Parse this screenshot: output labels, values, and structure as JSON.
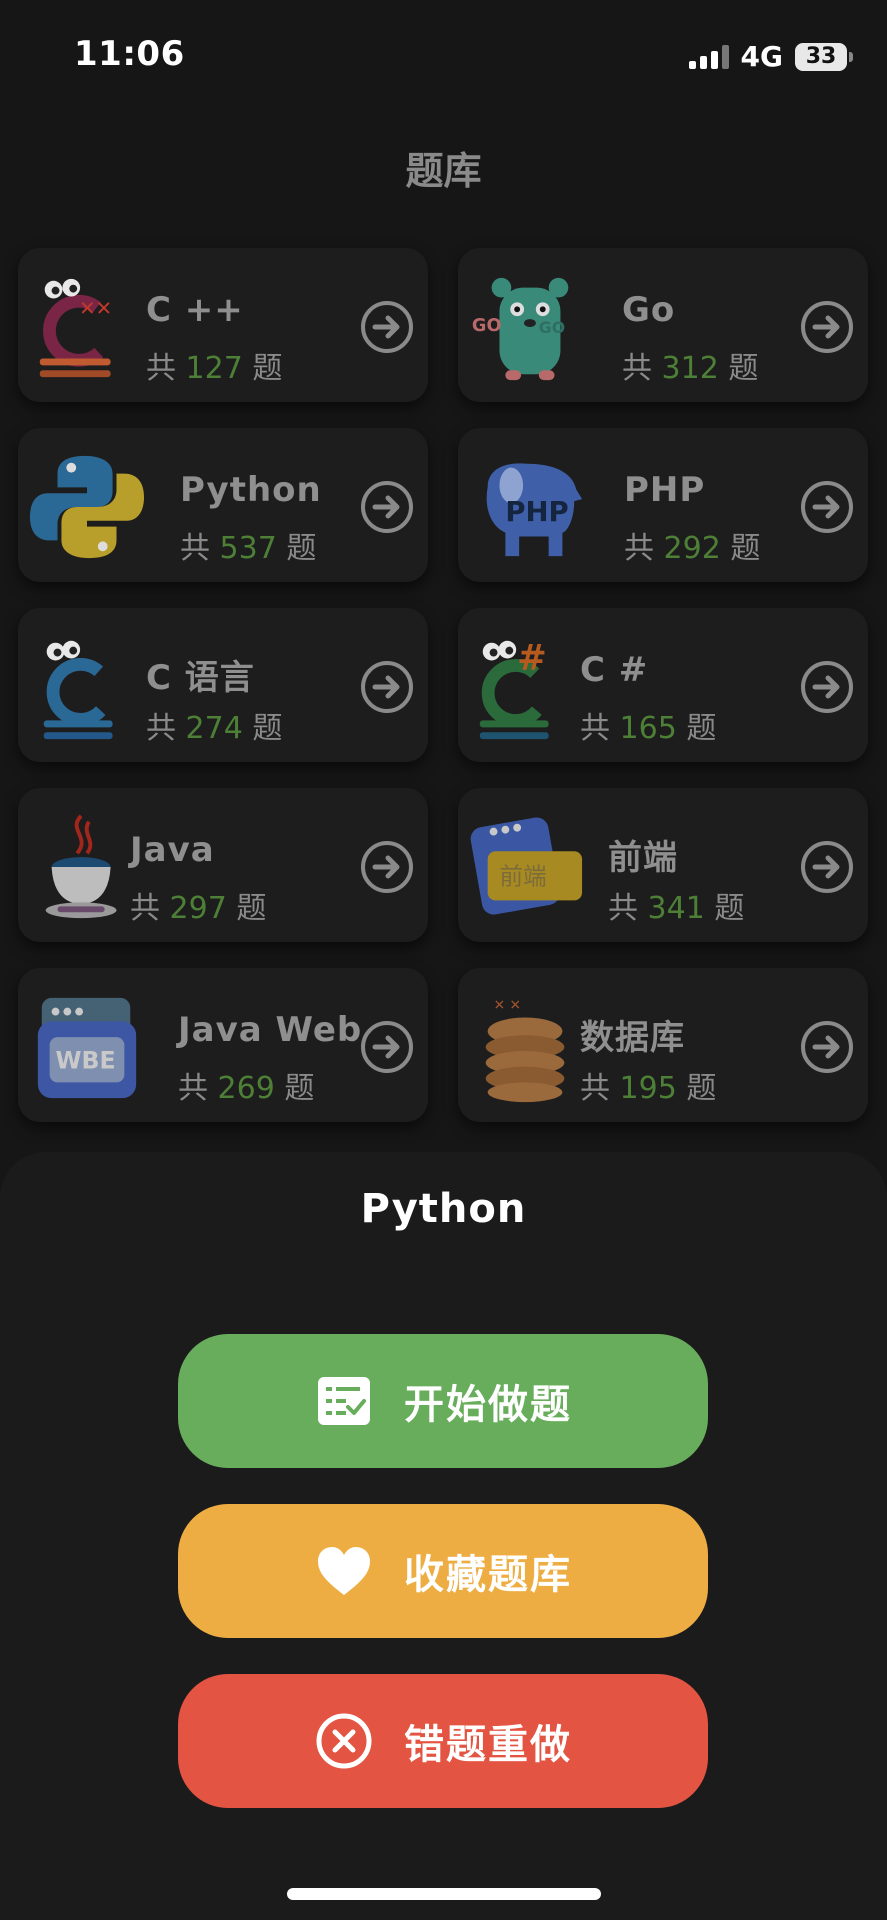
{
  "status_bar": {
    "time": "11:06",
    "network": "4G",
    "battery": "33"
  },
  "page_title": "题库",
  "cards": [
    {
      "id": "cpp",
      "name": "C ++",
      "prefix": "共",
      "count": "127",
      "suffix": "题"
    },
    {
      "id": "go",
      "name": "Go",
      "prefix": "共",
      "count": "312",
      "suffix": "题"
    },
    {
      "id": "python",
      "name": "Python",
      "prefix": "共",
      "count": "537",
      "suffix": "题"
    },
    {
      "id": "php",
      "name": "PHP",
      "prefix": "共",
      "count": "292",
      "suffix": "题"
    },
    {
      "id": "c",
      "name": "C 语言",
      "prefix": "共",
      "count": "274",
      "suffix": "题"
    },
    {
      "id": "csharp",
      "name": "C #",
      "prefix": "共",
      "count": "165",
      "suffix": "题"
    },
    {
      "id": "java",
      "name": "Java",
      "prefix": "共",
      "count": "297",
      "suffix": "题"
    },
    {
      "id": "frontend",
      "name": "前端",
      "prefix": "共",
      "count": "341",
      "suffix": "题",
      "icon_text": "前端"
    },
    {
      "id": "javaweb",
      "name": "Java Web",
      "prefix": "共",
      "count": "269",
      "suffix": "题",
      "icon_text": "WBE"
    },
    {
      "id": "database",
      "name": "数据库",
      "prefix": "共",
      "count": "195",
      "suffix": "题"
    }
  ],
  "icon_labels": {
    "php": "PHP",
    "go_left": "GO",
    "go_right": "GO"
  },
  "sheet": {
    "title": "Python",
    "buttons": [
      {
        "label": "开始做题",
        "icon": "checklist-icon",
        "color": "#67ad5b"
      },
      {
        "label": "收藏题库",
        "icon": "heart-icon",
        "color": "#edad43"
      },
      {
        "label": "错题重做",
        "icon": "close-circle-icon",
        "color": "#e35442"
      }
    ]
  }
}
